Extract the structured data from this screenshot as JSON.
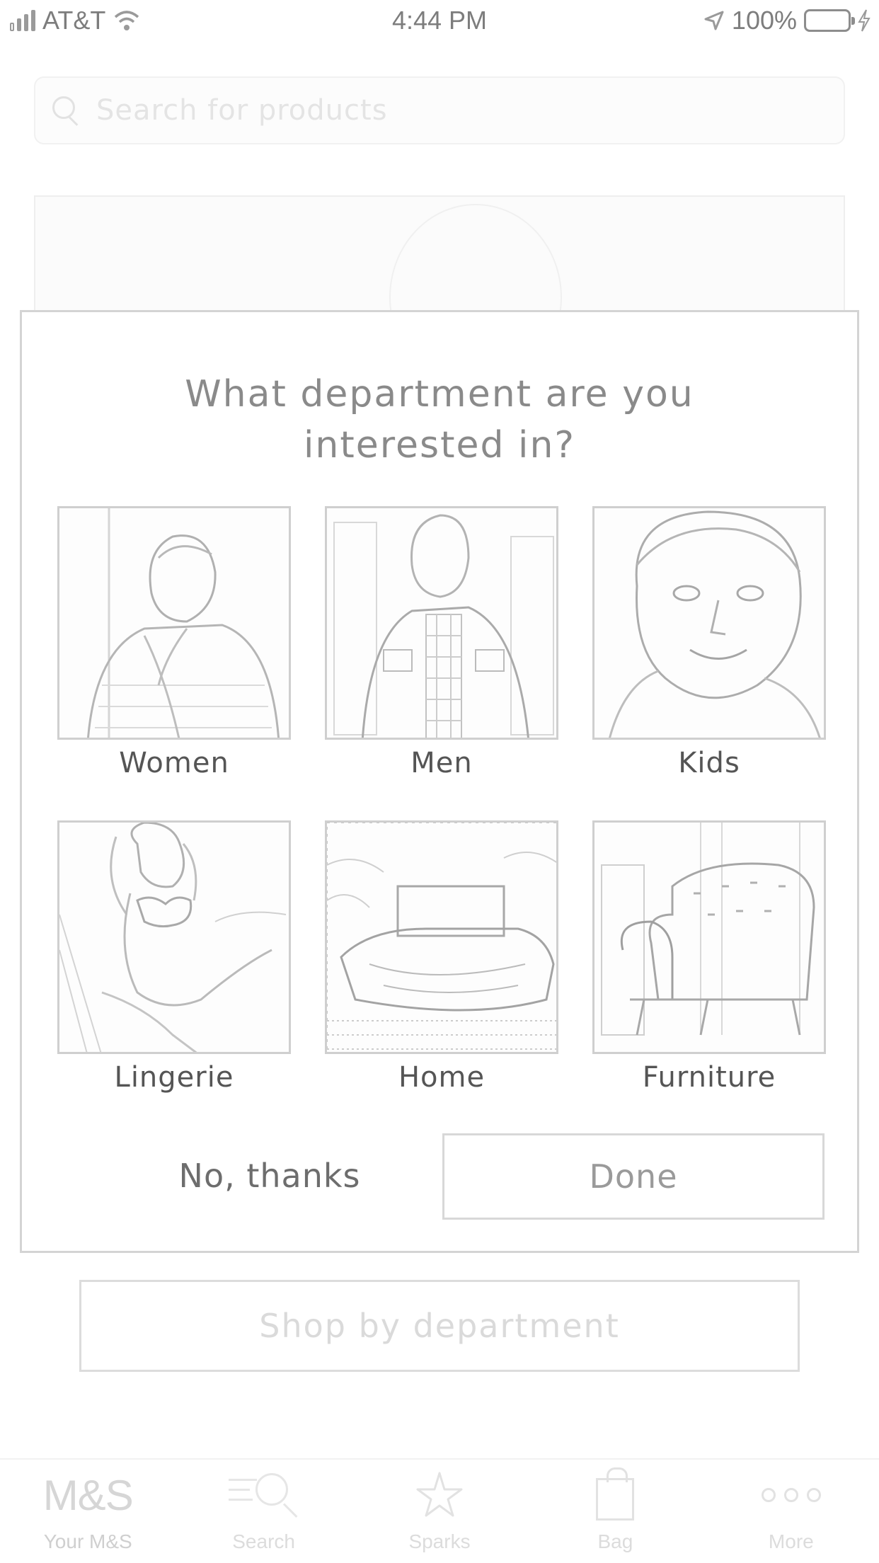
{
  "status_bar": {
    "carrier": "AT&T",
    "time": "4:44 PM",
    "battery": "100%"
  },
  "search": {
    "placeholder": "Search for products"
  },
  "modal": {
    "title_line1": "What department are you",
    "title_line2": "interested in?",
    "departments": [
      {
        "label": "Women",
        "icon": "women-photo"
      },
      {
        "label": "Men",
        "icon": "men-photo"
      },
      {
        "label": "Kids",
        "icon": "kids-photo"
      },
      {
        "label": "Lingerie",
        "icon": "lingerie-photo"
      },
      {
        "label": "Home",
        "icon": "home-photo"
      },
      {
        "label": "Furniture",
        "icon": "furniture-photo"
      }
    ],
    "no_thanks_label": "No, thanks",
    "done_label": "Done"
  },
  "page": {
    "shop_by_department_label": "Shop by department"
  },
  "tab_bar": {
    "items": [
      {
        "label": "Your M&S",
        "icon": "ms-logo",
        "logo_text": "M&S"
      },
      {
        "label": "Search",
        "icon": "search-icon"
      },
      {
        "label": "Sparks",
        "icon": "star-icon"
      },
      {
        "label": "Bag",
        "icon": "bag-icon"
      },
      {
        "label": "More",
        "icon": "more-icon"
      }
    ]
  },
  "colors": {
    "modal_border": "#d4d4d4",
    "text_dim": "#dadada",
    "text_label": "#555555"
  }
}
